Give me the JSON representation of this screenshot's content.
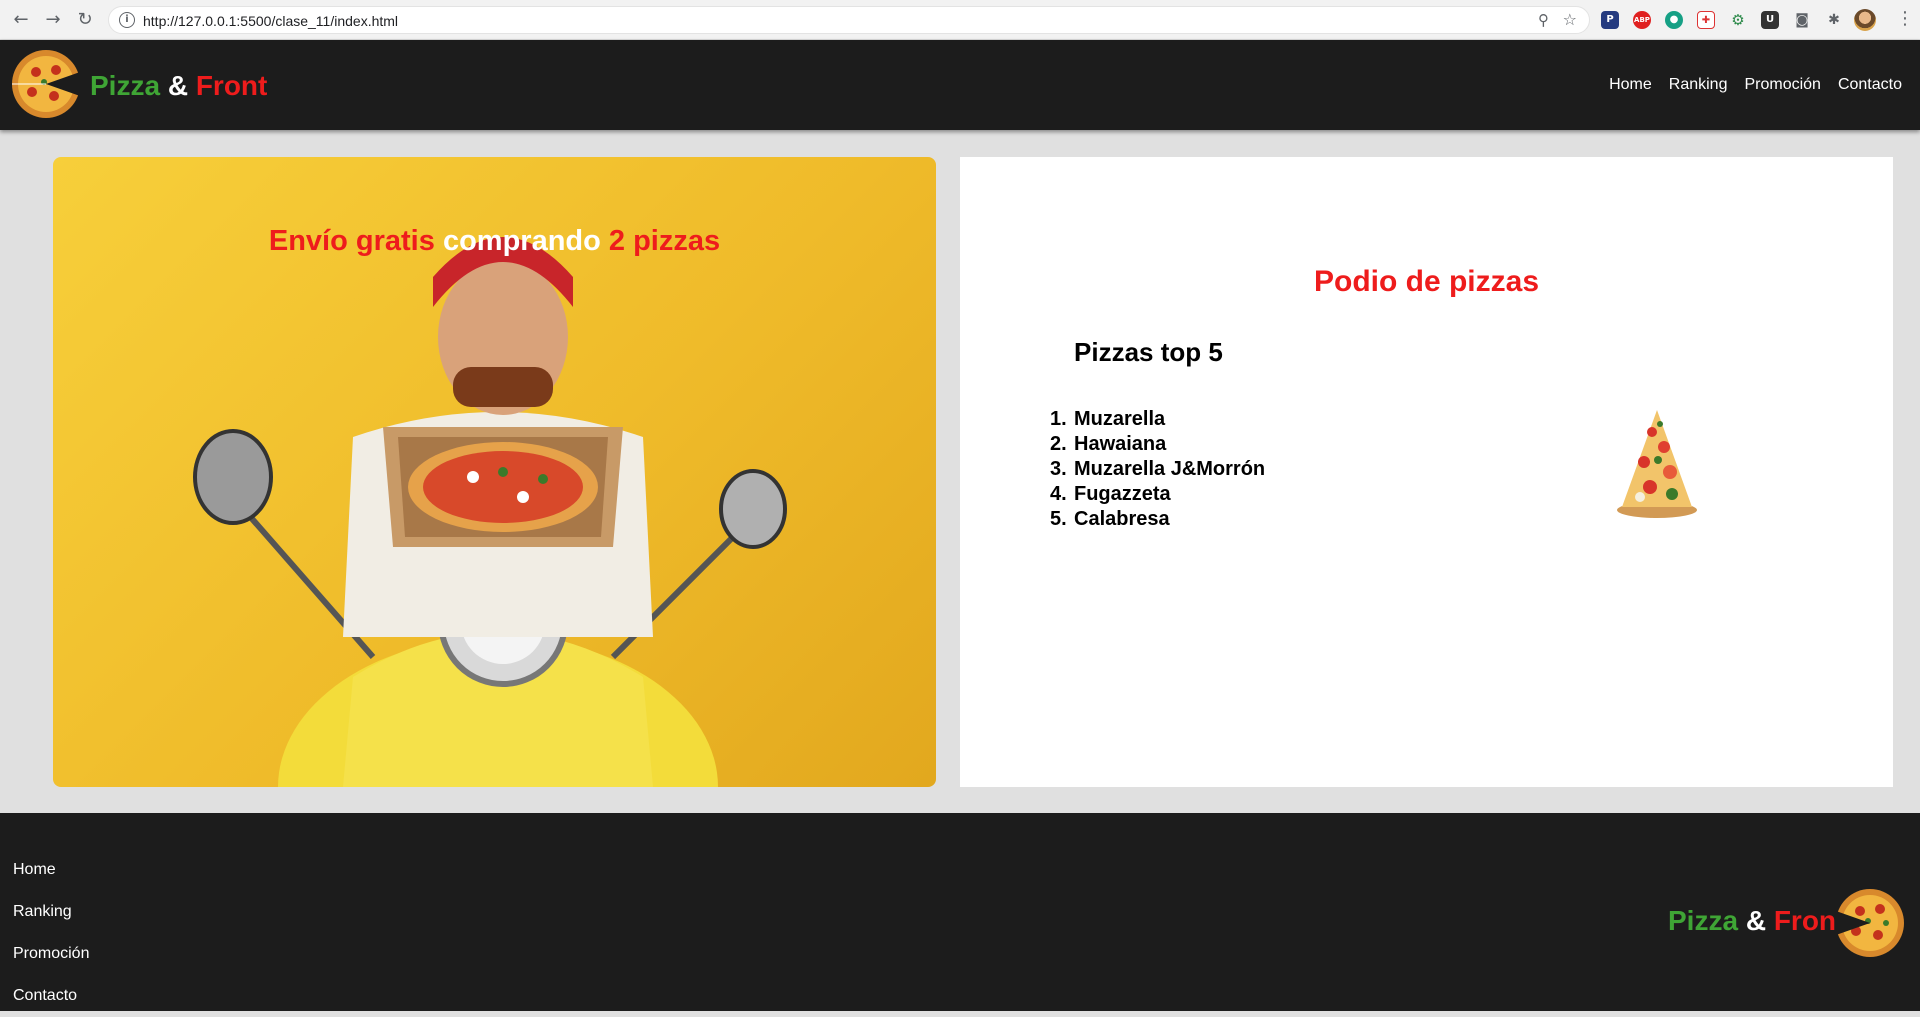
{
  "browser": {
    "url_host": "http://127.0.0.1",
    "url_path": ":5500/clase_11/index.html"
  },
  "header": {
    "brand": {
      "part1": "Pizza",
      "part2": "&",
      "part3": "Front"
    },
    "nav": [
      "Home",
      "Ranking",
      "Promoción",
      "Contacto"
    ]
  },
  "hero": {
    "title_part1": "Envío gratis",
    "title_part2": "comprando",
    "title_part3": "2 pizzas"
  },
  "podium": {
    "title": "Podio de pizzas",
    "subtitle": "Pizzas top 5",
    "items": [
      {
        "num": "1.",
        "name": "Muzarella"
      },
      {
        "num": "2.",
        "name": "Hawaiana"
      },
      {
        "num": "3.",
        "name": "Muzarella J&Morrón"
      },
      {
        "num": "4.",
        "name": "Fugazzeta"
      },
      {
        "num": "5.",
        "name": "Calabresa"
      }
    ]
  },
  "footer": {
    "nav": [
      "Home",
      "Ranking",
      "Promoción",
      "Contacto"
    ],
    "brand": {
      "part1": "Pizza",
      "part2": "&",
      "part3": "Front"
    }
  },
  "colors": {
    "header_bg": "#1c1c1c",
    "brand_green": "#3fa535",
    "brand_red": "#ee1c1c",
    "hero_yellow": "#f2c230",
    "page_bg": "#e0e0e0"
  }
}
